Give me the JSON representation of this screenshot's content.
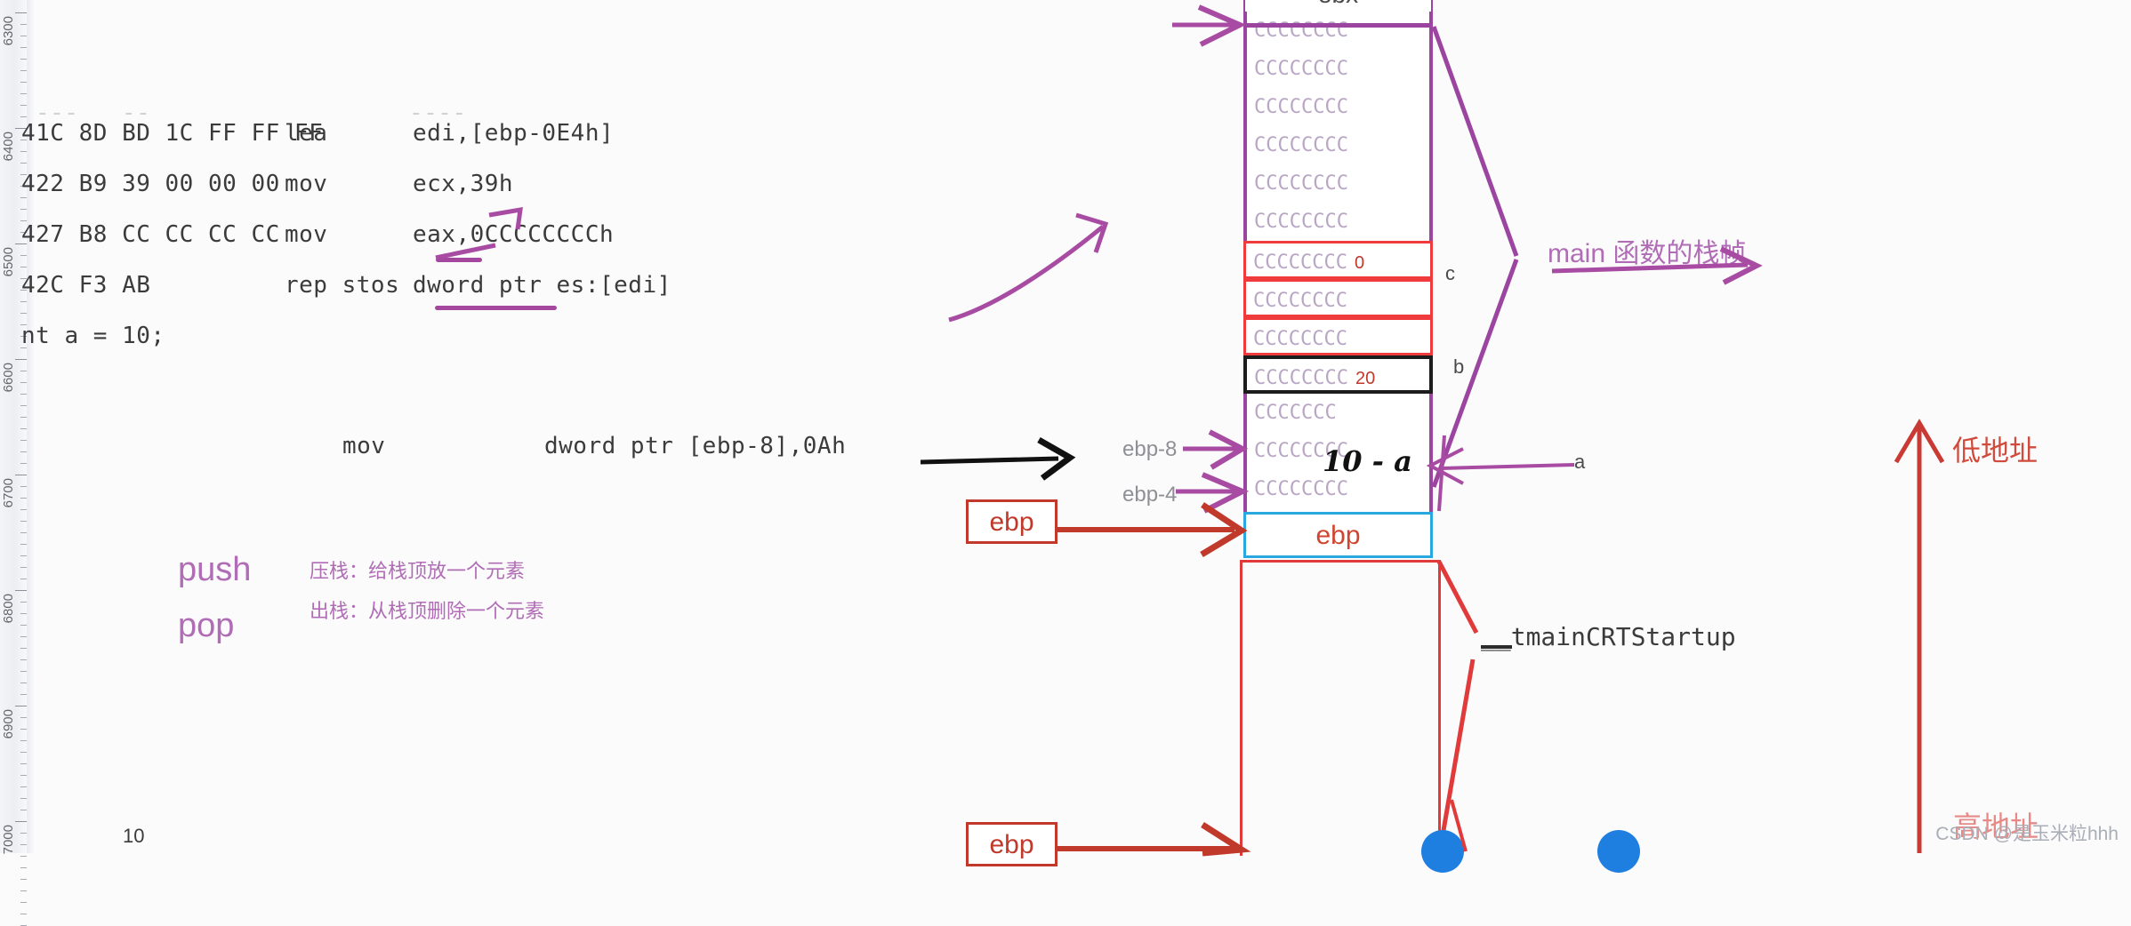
{
  "ruler": {
    "labels": [
      "6300",
      "6400",
      "6500",
      "6600",
      "6700",
      "6800",
      "6900",
      "7000"
    ]
  },
  "gutter": {
    "line_number": "10"
  },
  "code": {
    "ghost_row": "---   --                  ----",
    "rows": [
      {
        "bytes": "41C 8D BD 1C FF FF FF",
        "mnemonic": "lea",
        "operands": "edi,[ebp-0E4h]"
      },
      {
        "bytes": "422 B9 39 00 00 00",
        "mnemonic": "mov",
        "operands": "ecx,39h"
      },
      {
        "bytes": "427 B8 CC CC CC CC",
        "mnemonic": "mov",
        "operands": "eax,0CCCCCCCCh"
      },
      {
        "bytes": "42C F3 AB",
        "mnemonic": "rep stos",
        "operands": "dword ptr es:[edi]"
      }
    ],
    "source_line": "nt a = 10;",
    "mov_line": {
      "mnemonic": "mov",
      "operands": "dword ptr [ebp-8],0Ah"
    }
  },
  "notes": {
    "push_label": "push",
    "pop_label": "pop",
    "push_desc": "压栈：给栈顶放一个元素",
    "pop_desc": "出栈：从栈顶删除一个元素",
    "main_frame": "main 函数的栈帧",
    "crt_startup": "__tmainCRTStartup",
    "low_address": "低地址",
    "high_address": "高地址",
    "ebp_minus_8": "ebp-8",
    "ebp_minus_4": "ebp-4",
    "var_a": "a",
    "var_b": "b",
    "var_c": "c",
    "hand_annotation": "10 - a",
    "ebp_box_top": "ebp",
    "ebp_box_bottom": "ebp",
    "ebp_cell": "ebp"
  },
  "stack": {
    "top_label": "ebx",
    "cells": [
      {
        "text": "CCCCCCCC",
        "value": "",
        "style": "plain"
      },
      {
        "text": "CCCCCCCC",
        "value": "",
        "style": "plain"
      },
      {
        "text": "CCCCCCCC",
        "value": "",
        "style": "plain"
      },
      {
        "text": "CCCCCCCC",
        "value": "",
        "style": "plain"
      },
      {
        "text": "CCCCCCCC",
        "value": "",
        "style": "plain"
      },
      {
        "text": "CCCCCCCC",
        "value": "",
        "style": "plain"
      },
      {
        "text": "CCCCCCCC",
        "value": "0",
        "style": "red"
      },
      {
        "text": "CCCCCCCC",
        "value": "",
        "style": "red"
      },
      {
        "text": "CCCCCCCC",
        "value": "",
        "style": "red"
      },
      {
        "text": "CCCCCCCC",
        "value": "20",
        "style": "black"
      },
      {
        "text": "CCCCCCC",
        "value": "",
        "style": "plain"
      },
      {
        "text": "CCCCCCCC",
        "value": "",
        "style": "plain"
      },
      {
        "text": "CCCCCCCC",
        "value": "",
        "style": "plain"
      },
      {
        "text": "",
        "value": "",
        "style": "blank"
      }
    ]
  },
  "colors": {
    "pen_purple": "#a84ba2",
    "pen_red": "#d9382f",
    "cell_text": "#b9a6c4",
    "accent_blue": "#29a8df",
    "value_red": "#c0392b"
  },
  "watermark": "CSDN @是玉米粒hhh"
}
